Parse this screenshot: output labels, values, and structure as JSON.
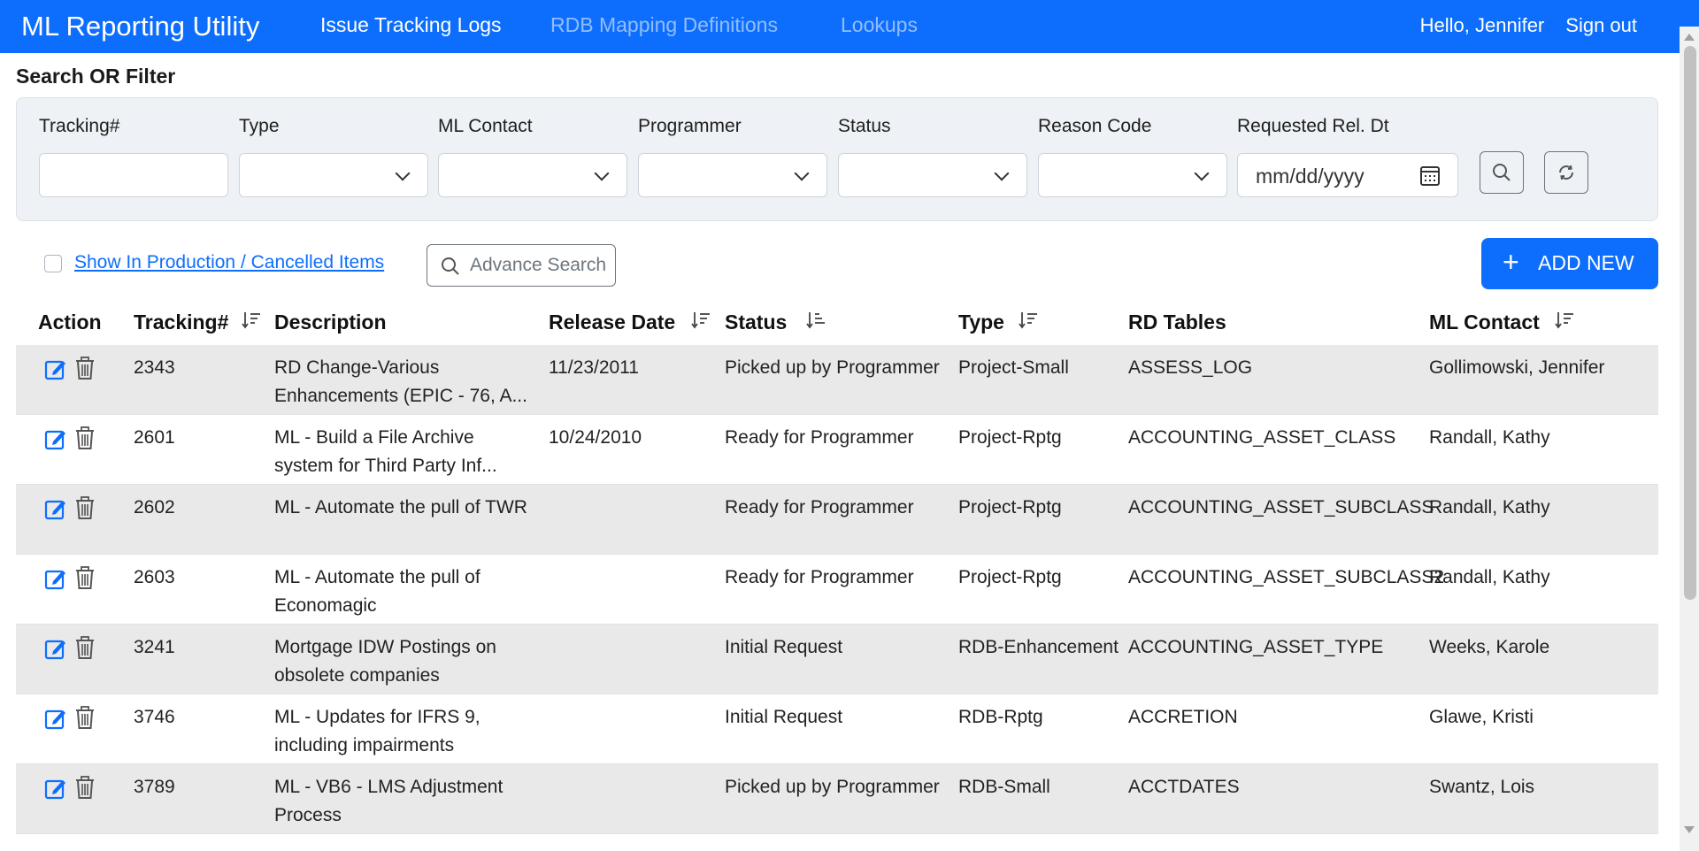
{
  "nav": {
    "brand": "ML Reporting Utility",
    "links": [
      "Issue Tracking Logs",
      "RDB Mapping Definitions",
      "Lookups"
    ],
    "greeting": "Hello,",
    "user": "Jennifer",
    "signout": "Sign out"
  },
  "search": {
    "title": "Search OR Filter",
    "labels": {
      "tracking": "Tracking#",
      "type": "Type",
      "ml_contact": "ML Contact",
      "programmer": "Programmer",
      "status": "Status",
      "reason_code": "Reason Code",
      "requested": "Requested Rel. Dt"
    },
    "date_placeholder": "mm/dd/yyyy"
  },
  "options": {
    "show_production": "Show In Production / Cancelled Items",
    "advance_search": "Advance Search",
    "add_new": "ADD NEW",
    "add_icon": "plus-icon"
  },
  "table": {
    "headers": {
      "action": "Action",
      "tracking": "Tracking#",
      "description": "Description",
      "release_date": "Release Date",
      "status": "Status",
      "type": "Type",
      "rd_tables": "RD Tables",
      "ml_contact": "ML Contact"
    },
    "rows": [
      {
        "tracking": "2343",
        "description": "RD Change-Various Enhancements (EPIC - 76, A...",
        "release_date": "11/23/2011",
        "status": "Picked up by Programmer",
        "type": "Project-Small",
        "rd_tables": "ASSESS_LOG",
        "ml_contact": "Gollimowski, Jennifer"
      },
      {
        "tracking": "2601",
        "description": "ML - Build a File Archive system for Third Party Inf...",
        "release_date": "10/24/2010",
        "status": "Ready for Programmer",
        "type": "Project-Rptg",
        "rd_tables": "ACCOUNTING_ASSET_CLASS",
        "ml_contact": "Randall, Kathy"
      },
      {
        "tracking": "2602",
        "description": "ML - Automate the pull of TWR",
        "release_date": "",
        "status": "Ready for Programmer",
        "type": "Project-Rptg",
        "rd_tables": "ACCOUNTING_ASSET_SUBCLASS",
        "ml_contact": "Randall, Kathy"
      },
      {
        "tracking": "2603",
        "description": "ML - Automate the pull of Economagic",
        "release_date": "",
        "status": "Ready for Programmer",
        "type": "Project-Rptg",
        "rd_tables": "ACCOUNTING_ASSET_SUBCLASS2",
        "ml_contact": "Randall, Kathy"
      },
      {
        "tracking": "3241",
        "description": "Mortgage IDW Postings on obsolete companies",
        "release_date": "",
        "status": "Initial Request",
        "type": "RDB-Enhancement",
        "rd_tables": "ACCOUNTING_ASSET_TYPE",
        "ml_contact": "Weeks, Karole"
      },
      {
        "tracking": "3746",
        "description": "ML - Updates for IFRS 9, including impairments",
        "release_date": "",
        "status": "Initial Request",
        "type": "RDB-Rptg",
        "rd_tables": "ACCRETION",
        "ml_contact": "Glawe, Kristi"
      },
      {
        "tracking": "3789",
        "description": "ML - VB6 - LMS Adjustment Process",
        "release_date": "",
        "status": "Picked up by Programmer",
        "type": "RDB-Small",
        "rd_tables": "ACCTDATES",
        "ml_contact": "Swantz, Lois"
      }
    ]
  },
  "colors": {
    "primary": "#0d6efd",
    "row_stripe": "#e9e9e9",
    "filter_bg": "#eef1f5"
  }
}
